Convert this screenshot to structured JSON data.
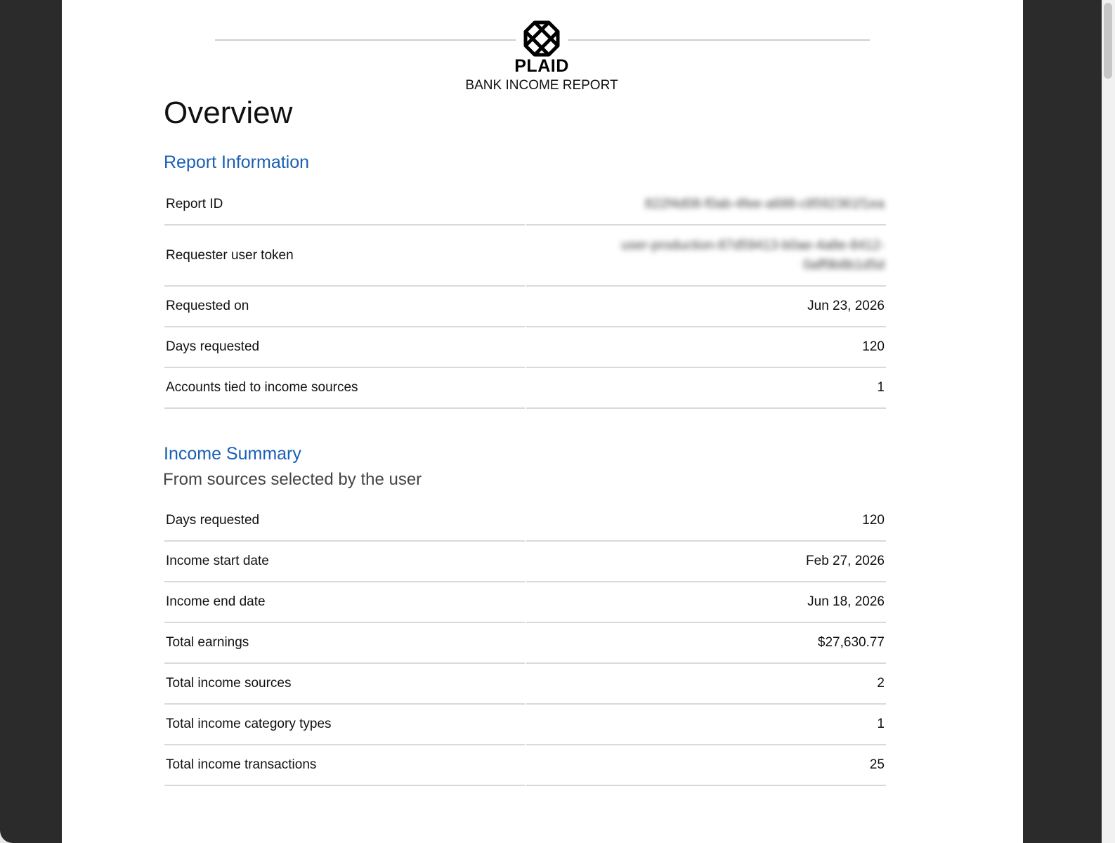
{
  "header": {
    "brand": "PLAID",
    "report_type": "BANK INCOME REPORT"
  },
  "page_title": "Overview",
  "report_information": {
    "title": "Report Information",
    "rows": [
      {
        "label": "Report ID",
        "value": "822f4d08-f0ab-4fee-a688-c8592361f1ea"
      },
      {
        "label": "Requester user token",
        "value_line1": "user-production-87d59413-b0ae-4a8e-8412-",
        "value_line2": "0aff9b8b1d5d"
      },
      {
        "label": "Requested on",
        "value": "Jun 23, 2026"
      },
      {
        "label": "Days requested",
        "value": "120"
      },
      {
        "label": "Accounts tied to income sources",
        "value": "1"
      }
    ]
  },
  "income_summary": {
    "title": "Income Summary",
    "subtitle": "From sources selected by the user",
    "rows": [
      {
        "label": "Days requested",
        "value": "120"
      },
      {
        "label": "Income start date",
        "value": "Feb 27, 2026"
      },
      {
        "label": "Income end date",
        "value": "Jun 18, 2026"
      },
      {
        "label": "Total earnings",
        "value": "$27,630.77"
      },
      {
        "label": "Total income sources",
        "value": "2"
      },
      {
        "label": "Total income category types",
        "value": "1"
      },
      {
        "label": "Total income transactions",
        "value": "25"
      }
    ]
  }
}
